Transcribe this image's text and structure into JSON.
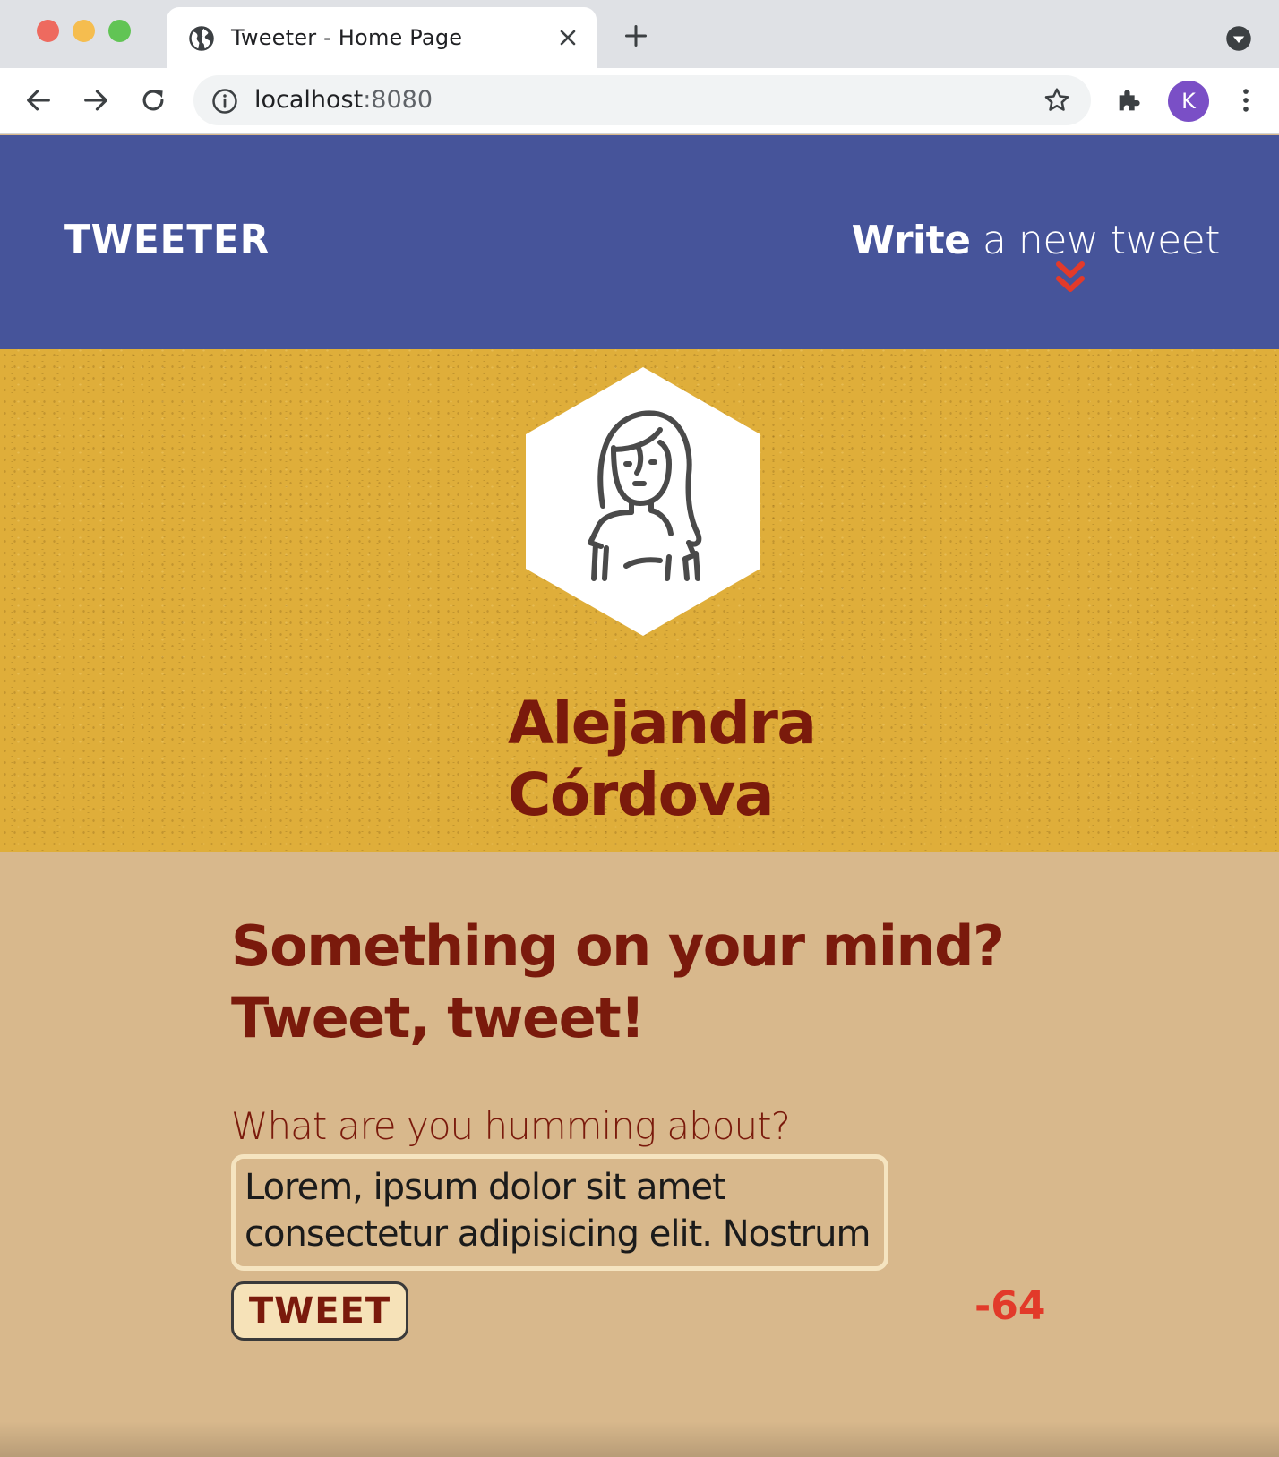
{
  "browser": {
    "tab_title": "Tweeter - Home Page",
    "url_host": "localhost",
    "url_port": ":8080",
    "profile_initial": "K",
    "icons": [
      "globe-icon",
      "close-icon",
      "plus-icon",
      "tab-menu-icon",
      "back-icon",
      "forward-icon",
      "reload-icon",
      "info-icon",
      "star-icon",
      "extensions-icon",
      "more-icon"
    ]
  },
  "nav": {
    "brand": "TWEETER",
    "write_bold": "Write",
    "write_rest": " a new tweet",
    "accent": "#e23a2a"
  },
  "profile": {
    "name_line1": "Alejandra",
    "name_line2": "Córdova"
  },
  "compose": {
    "heading_line1": "Something on your mind?",
    "heading_line2": "Tweet, tweet!",
    "prompt": "What are you humming about?",
    "textarea_value": "Lorem, ipsum dolor sit amet consectetur adipisicing elit. Nostrum",
    "button_label": "TWEET",
    "counter": "-64"
  },
  "colors": {
    "nav_bg": "#46549a",
    "profile_bg": "#dfae3a",
    "compose_bg": "#d8b88c",
    "text_dark_red": "#7a1a0c"
  }
}
